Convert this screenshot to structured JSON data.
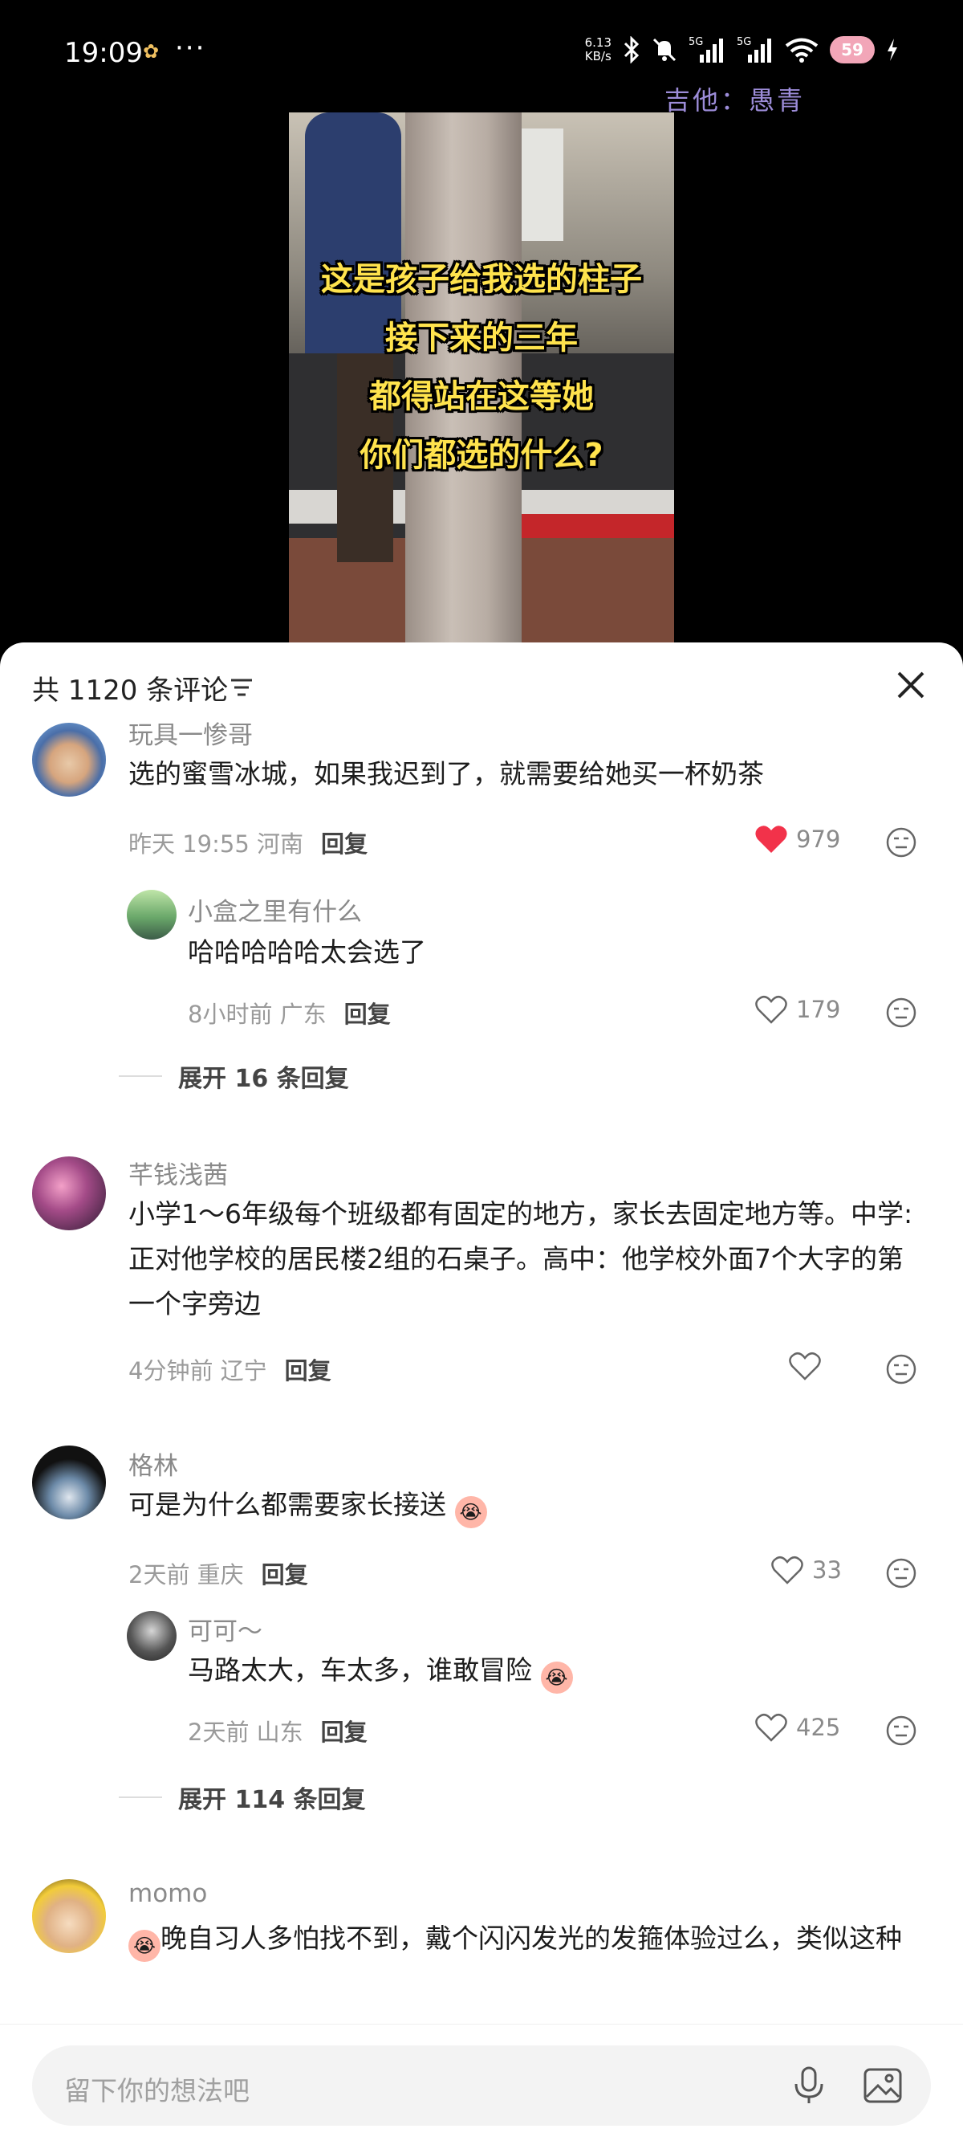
{
  "status_bar": {
    "time": "19:09",
    "dots": "···",
    "speed_value": "6.13",
    "speed_unit": "KB/s",
    "signal1": "5G",
    "signal2": "5G",
    "battery": "59"
  },
  "watermark": "吉他：愚青",
  "video": {
    "caption_lines": [
      "这是孩子给我选的柱子",
      "接下来的三年",
      "都得站在这等她",
      "你们都选的什么?"
    ]
  },
  "sheet": {
    "comment_count": "共 1120 条评论"
  },
  "comments": [
    {
      "username": "玩具一惨哥",
      "text": "选的蜜雪冰城，如果我迟到了，就需要给她买一杯奶茶",
      "meta": "昨天 19:55 河南",
      "reply": "回复",
      "likes": "979",
      "liked": true,
      "replies": [
        {
          "username": "小盒之里有什么",
          "text": "哈哈哈哈哈太会选了",
          "meta": "8小时前 广东",
          "reply": "回复",
          "likes": "179"
        }
      ],
      "expand": "展开 16 条回复"
    },
    {
      "username": "芊钱浅茜",
      "text": "小学1～6年级每个班级都有固定的地方，家长去固定地方等。中学: 正对他学校的居民楼2组的石桌子。高中：他学校外面7个大字的第一个字旁边",
      "meta": "4分钟前 辽宁",
      "reply": "回复",
      "likes": ""
    },
    {
      "username": "格林",
      "text": "可是为什么都需要家长接送",
      "meta": "2天前 重庆",
      "reply": "回复",
      "likes": "33",
      "replies": [
        {
          "username": "可可～",
          "text": "马路太大，车太多，谁敢冒险",
          "meta": "2天前 山东",
          "reply": "回复",
          "likes": "425"
        }
      ],
      "expand": "展开 114 条回复"
    },
    {
      "username": "momo",
      "text": "晚自习人多怕找不到，戴个闪闪发光的发箍体验过么，类似这种"
    }
  ],
  "input": {
    "placeholder": "留下你的想法吧"
  },
  "colors": {
    "like_red": "#f2324a",
    "caption_yellow": "#ffe34d",
    "watermark_purple": "#9c8cd8"
  }
}
